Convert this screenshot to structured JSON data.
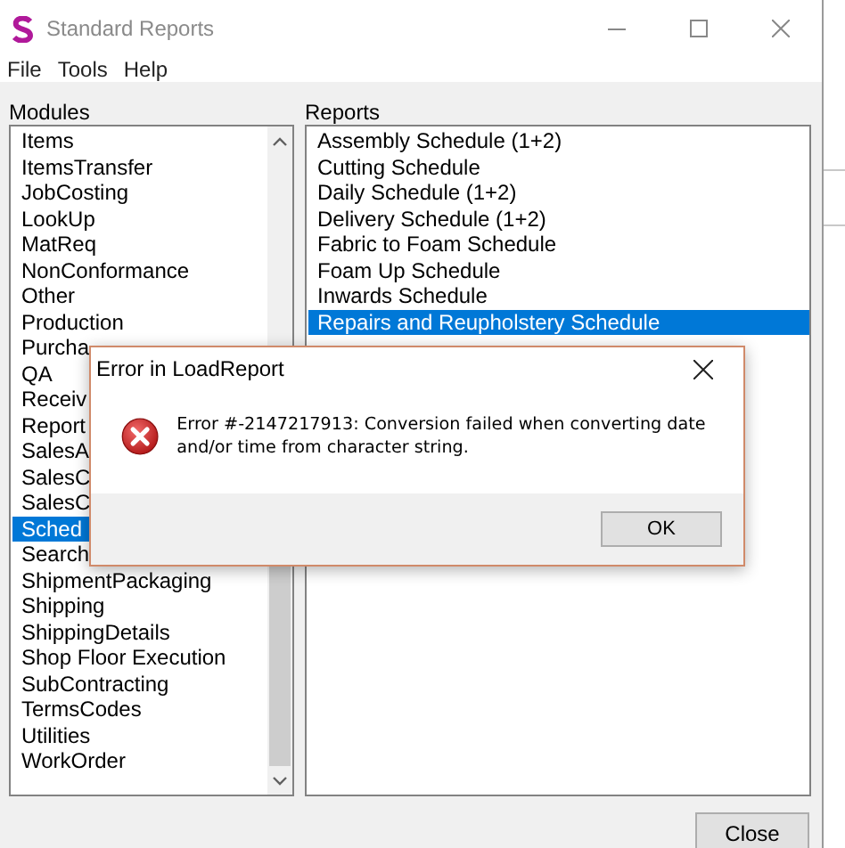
{
  "window": {
    "title": "Standard Reports"
  },
  "menu": [
    "File",
    "Tools",
    "Help"
  ],
  "modules": {
    "label": "Modules",
    "items": [
      {
        "label": "Items",
        "selected": false
      },
      {
        "label": "ItemsTransfer",
        "selected": false
      },
      {
        "label": "JobCosting",
        "selected": false
      },
      {
        "label": "LookUp",
        "selected": false
      },
      {
        "label": "MatReq",
        "selected": false
      },
      {
        "label": "NonConformance",
        "selected": false
      },
      {
        "label": "Other",
        "selected": false
      },
      {
        "label": "Production",
        "selected": false
      },
      {
        "label": "Purcha",
        "selected": false
      },
      {
        "label": "QA",
        "selected": false
      },
      {
        "label": "Receiv",
        "selected": false
      },
      {
        "label": "Report",
        "selected": false
      },
      {
        "label": "SalesA",
        "selected": false
      },
      {
        "label": "SalesC",
        "selected": false
      },
      {
        "label": "SalesC",
        "selected": false
      },
      {
        "label": "Sched",
        "selected": true
      },
      {
        "label": "Search",
        "selected": false
      },
      {
        "label": "ShipmentPackaging",
        "selected": false
      },
      {
        "label": "Shipping",
        "selected": false
      },
      {
        "label": "ShippingDetails",
        "selected": false
      },
      {
        "label": "Shop Floor Execution",
        "selected": false
      },
      {
        "label": "SubContracting",
        "selected": false
      },
      {
        "label": "TermsCodes",
        "selected": false
      },
      {
        "label": "Utilities",
        "selected": false
      },
      {
        "label": "WorkOrder",
        "selected": false
      }
    ]
  },
  "reports": {
    "label": "Reports",
    "items": [
      {
        "label": "Assembly Schedule (1+2)",
        "selected": false
      },
      {
        "label": "Cutting Schedule",
        "selected": false
      },
      {
        "label": "Daily Schedule (1+2)",
        "selected": false
      },
      {
        "label": "Delivery Schedule (1+2)",
        "selected": false
      },
      {
        "label": "Fabric to Foam Schedule",
        "selected": false
      },
      {
        "label": "Foam Up Schedule",
        "selected": false
      },
      {
        "label": "Inwards Schedule",
        "selected": false
      },
      {
        "label": "Repairs and Reupholstery Schedule",
        "selected": true
      }
    ]
  },
  "buttons": [
    "Close"
  ],
  "dialog": {
    "title": "Error in LoadReport",
    "message": "Error #-2147217913: Conversion failed when converting date and/or time from character string.",
    "buttons": [
      "OK"
    ]
  }
}
